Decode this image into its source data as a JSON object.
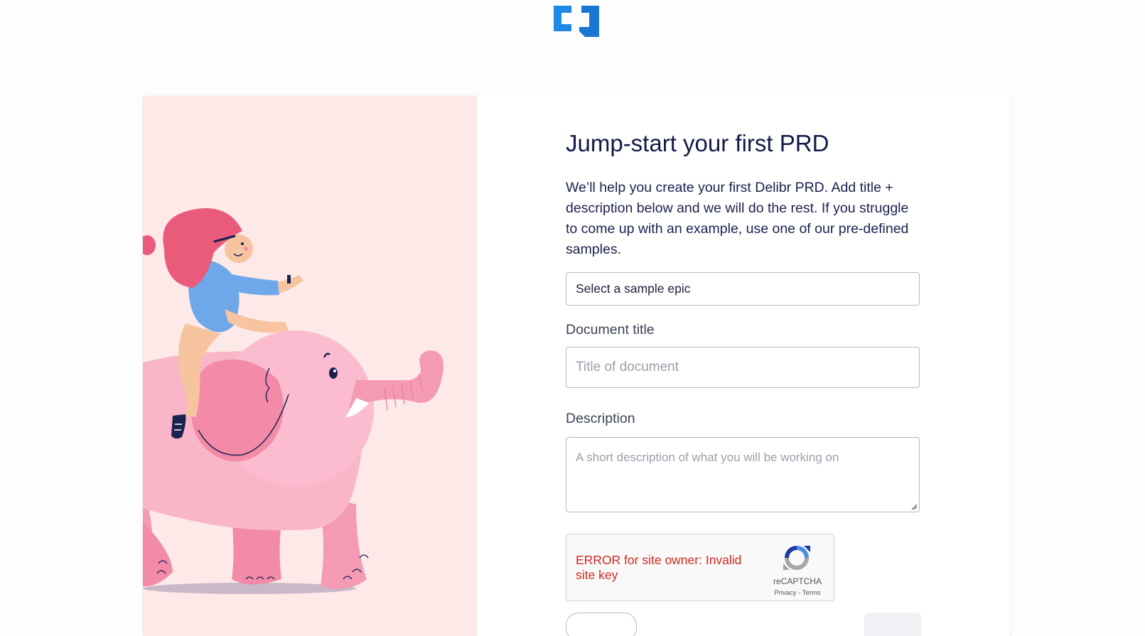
{
  "brand": {
    "logo_icon": "delibr-logo-icon",
    "accent_color": "#1e88e5"
  },
  "illustration": {
    "icon": "girl-riding-elephant-illustration",
    "background_color": "#fde9e7"
  },
  "form": {
    "heading": "Jump-start your first PRD",
    "intro": "We’ll help you create your first Delibr PRD. Add title + description below and we will do the rest. If you struggle to come up with an example, use one of our pre-defined samples.",
    "sample_select": {
      "value": "Select a sample epic"
    },
    "title_field": {
      "label": "Document title",
      "value": "",
      "placeholder": "Title of document"
    },
    "description_field": {
      "label": "Description",
      "value": "",
      "placeholder": "A short description of what you will be working on"
    }
  },
  "recaptcha": {
    "error_text": "ERROR for site owner: Invalid site key",
    "brand": "reCAPTCHA",
    "privacy_link": "Privacy",
    "separator": " - ",
    "terms_link": "Terms",
    "icon": "recaptcha-icon",
    "error_color": "#d22a1f"
  }
}
